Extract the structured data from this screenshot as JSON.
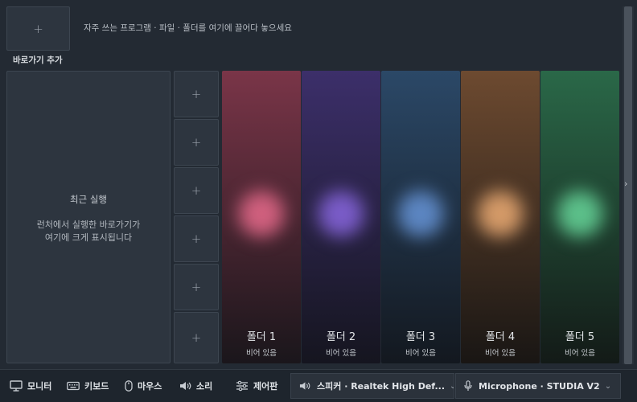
{
  "top": {
    "add_icon": "plus-icon",
    "hint": "자주 쓰는 프로그램 · 파일 · 폴더를 여기에 끌어다 놓으세요",
    "add_label": "바로가기 추가"
  },
  "recent": {
    "title": "최근 실행",
    "desc_line1": "런처에서 실행한 바로가기가",
    "desc_line2": "여기에 크게 표시됩니다"
  },
  "slots": [
    "+",
    "+",
    "+",
    "+",
    "+",
    "+"
  ],
  "folders": [
    {
      "name": "폴더 1",
      "status": "비어 있음",
      "top": "#7a3548",
      "bottom": "#1a161b",
      "glow": "#d0607e"
    },
    {
      "name": "폴더 2",
      "status": "비어 있음",
      "top": "#3c2f6a",
      "bottom": "#15151f",
      "glow": "#7a5cc8"
    },
    {
      "name": "폴더 3",
      "status": "비어 있음",
      "top": "#2b4867",
      "bottom": "#13181f",
      "glow": "#5c86c2"
    },
    {
      "name": "폴더 4",
      "status": "비어 있음",
      "top": "#6d4a30",
      "bottom": "#191614",
      "glow": "#d49a68"
    },
    {
      "name": "폴더 5",
      "status": "비어 있음",
      "top": "#2a6848",
      "bottom": "#131a17",
      "glow": "#5cc08a"
    }
  ],
  "scroll_icon": "chevron-right-icon",
  "toolbar": {
    "monitor": "모니터",
    "keyboard": "키보드",
    "mouse": "마우스",
    "sound": "소리",
    "control": "제어판",
    "speaker": "스피커 · Realtek High Def...",
    "microphone": "Microphone · STUDIA V2"
  }
}
